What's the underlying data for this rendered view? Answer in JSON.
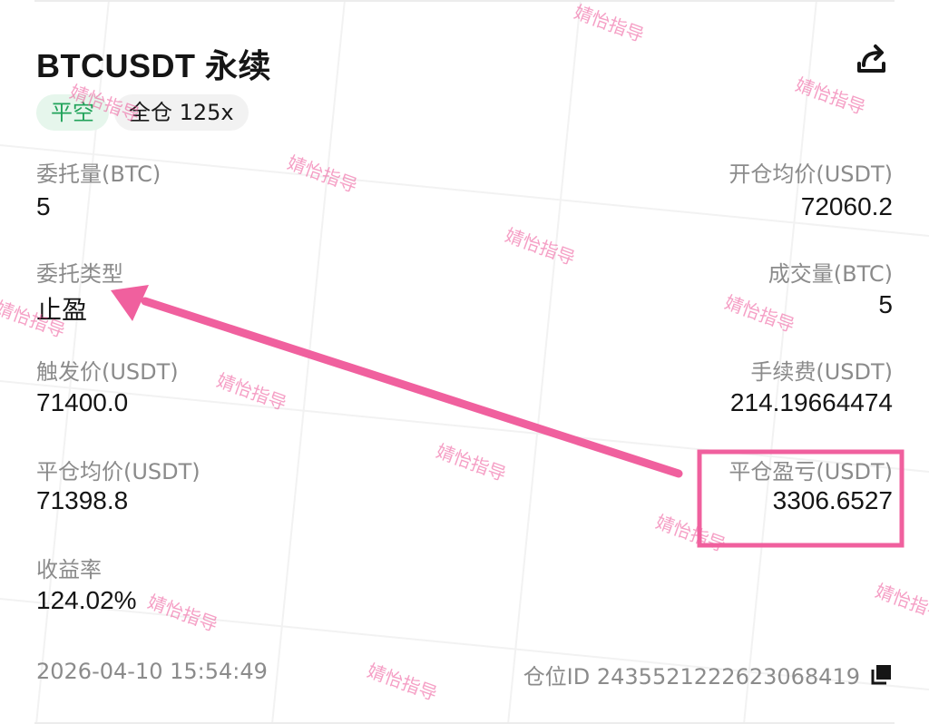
{
  "header": {
    "title": "BTCUSDT 永续",
    "share_icon": "share-icon"
  },
  "tags": {
    "direction": "平空",
    "margin_leverage": "全仓 125x"
  },
  "fields": {
    "order_qty_label": "委托量(BTC)",
    "order_qty_value": "5",
    "open_avg_label": "开仓均价(USDT)",
    "open_avg_value": "72060.2",
    "order_type_label": "委托类型",
    "order_type_value": "止盈",
    "filled_qty_label": "成交量(BTC)",
    "filled_qty_value": "5",
    "trigger_price_label": "触发价(USDT)",
    "trigger_price_value": "71400.0",
    "fee_label": "手续费(USDT)",
    "fee_value": "214.19664474",
    "close_avg_label": "平仓均价(USDT)",
    "close_avg_value": "71398.8",
    "close_pnl_label": "平仓盈亏(USDT)",
    "close_pnl_value": "3306.6527",
    "roi_label": "收益率",
    "roi_value": "124.02%"
  },
  "footer": {
    "timestamp": "2026-04-10 15:54:49",
    "position_id": "仓位ID 2435521222623068419",
    "copy_icon": "copy-icon"
  },
  "watermark": "婧怡指导",
  "colors": {
    "short_green": "#21a35a",
    "short_bg": "#e6f6ec",
    "annotation_pink": "#f0609e",
    "label_gray": "#8b8b8b"
  }
}
